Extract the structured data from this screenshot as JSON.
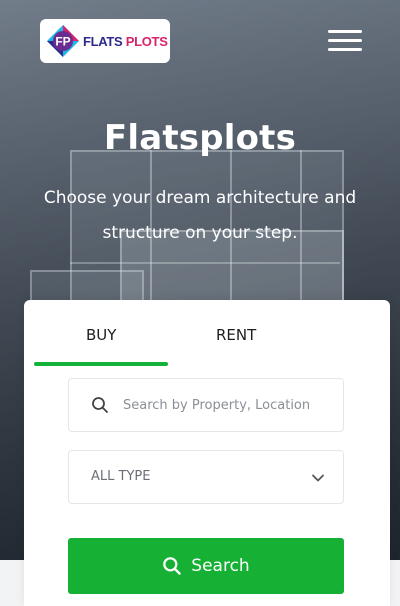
{
  "header": {
    "logo_word1": "FLATS",
    "logo_word2": "PLOTS",
    "logo_monogram": "FP",
    "menu_icon": "hamburger-menu-icon"
  },
  "hero": {
    "title": "Flatsplots",
    "subtitle": "Choose your dream architecture and structure on your step."
  },
  "search_card": {
    "tabs": [
      {
        "label": "BUY",
        "active": true
      },
      {
        "label": "RENT",
        "active": false
      }
    ],
    "search_input": {
      "placeholder": "Search by Property, Location",
      "value": "",
      "icon": "search-icon"
    },
    "type_select": {
      "selected": "ALL TYPE",
      "icon": "chevron-down-icon"
    },
    "search_button": {
      "label": "Search",
      "icon": "search-icon"
    }
  },
  "colors": {
    "accent_green": "#16b134",
    "logo_navy": "#2d2a8c",
    "logo_pink": "#d9236b",
    "logo_cyan": "#1fb6e8"
  }
}
